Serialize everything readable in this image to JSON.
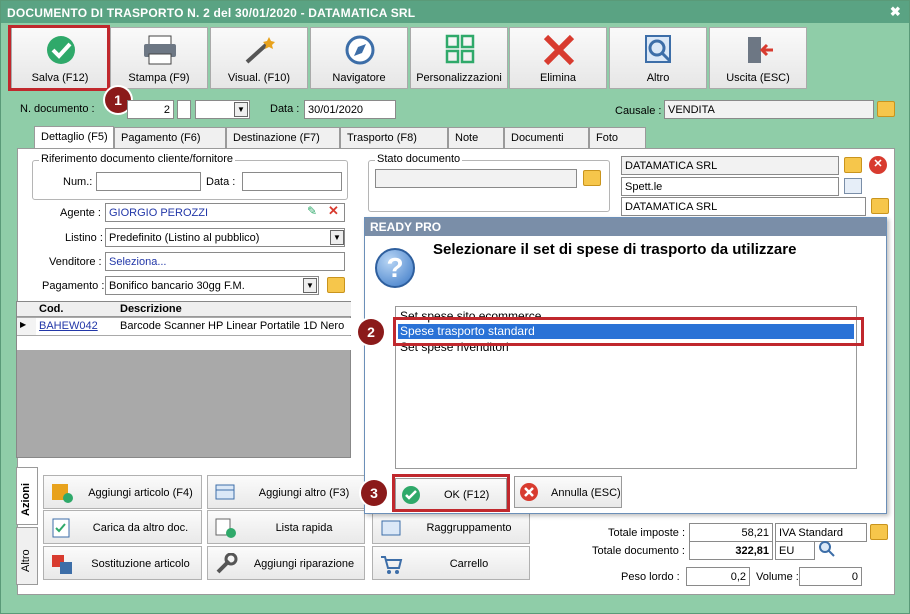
{
  "window": {
    "title": "DOCUMENTO DI TRASPORTO N. 2 del 30/01/2020 - DATAMATICA SRL",
    "close_glyph": "✖"
  },
  "toolbar": [
    {
      "label": "Salva (F12)",
      "icon": "check-icon"
    },
    {
      "label": "Stampa (F9)",
      "icon": "printer-icon"
    },
    {
      "label": "Visual. (F10)",
      "icon": "magic-wand-icon"
    },
    {
      "label": "Navigatore",
      "icon": "compass-icon"
    },
    {
      "label": "Personalizzazioni",
      "icon": "grid-icon"
    },
    {
      "label": "Elimina",
      "icon": "delete-x-icon"
    },
    {
      "label": "Altro",
      "icon": "magnifier-icon"
    },
    {
      "label": "Uscita (ESC)",
      "icon": "exit-door-icon"
    }
  ],
  "header": {
    "num_label": "N. documento :",
    "num_value": "2",
    "data_label": "Data :",
    "data_value": "30/01/2020",
    "causale_label": "Causale :",
    "causale_value": "VENDITA"
  },
  "tabs": [
    "Dettaglio (F5)",
    "Pagamento (F6)",
    "Destinazione (F7)",
    "Trasporto (F8)",
    "Note",
    "Documenti",
    "Foto"
  ],
  "riferimento": {
    "title": "Riferimento documento cliente/fornitore",
    "num_label": "Num.:",
    "data_label": "Data :"
  },
  "stato": {
    "title": "Stato documento"
  },
  "cliente": {
    "line1": "DATAMATICA SRL",
    "line2": "Spett.le",
    "line3": "DATAMATICA SRL"
  },
  "fields": {
    "agente_label": "Agente :",
    "agente_value": "GIORGIO PEROZZI",
    "listino_label": "Listino :",
    "listino_value": "Predefinito (Listino al pubblico)",
    "venditore_label": "Venditore :",
    "venditore_value": "Seleziona...",
    "pagamento_label": "Pagamento :",
    "pagamento_value": "Bonifico bancario 30gg F.M."
  },
  "grid": {
    "headers": [
      "Cod.",
      "Descrizione"
    ],
    "rows": [
      {
        "cod": "BAHEW042",
        "desc": "Barcode Scanner HP Linear Portatile 1D Nero"
      }
    ]
  },
  "side_tabs": [
    "Azioni",
    "Altro"
  ],
  "actions": [
    {
      "label": "Aggiungi articolo (F4)",
      "icon": "add-article-icon"
    },
    {
      "label": "Aggiungi altro (F3)",
      "icon": "add-other-icon"
    },
    {
      "label": "Carica da altro doc.",
      "icon": "load-doc-icon"
    },
    {
      "label": "Lista rapida",
      "icon": "quick-list-icon"
    },
    {
      "label": "Raggruppamento",
      "icon": "group-icon"
    },
    {
      "label": "Sostituzione articolo",
      "icon": "replace-icon"
    },
    {
      "label": "Aggiungi riparazione",
      "icon": "wrench-icon"
    },
    {
      "label": "Carrello",
      "icon": "cart-icon"
    }
  ],
  "totals": {
    "imposte_label": "Totale imposte :",
    "imposte_value": "58,21",
    "iva_value": "IVA Standard",
    "documento_label": "Totale documento :",
    "documento_value": "322,81",
    "valuta": "EU",
    "peso_label": "Peso lordo :",
    "peso_value": "0,2",
    "volume_label": "Volume :",
    "volume_value": "0"
  },
  "dialog": {
    "title": "READY PRO",
    "message": "Selezionare il set di spese di trasporto da utilizzare",
    "options": [
      "Set spese sito ecommerce",
      "Spese trasporto standard",
      "Set spese rivenditori"
    ],
    "selected_index": 1,
    "ok_label": "OK (F12)",
    "cancel_label": "Annulla (ESC)"
  },
  "badges": [
    "1",
    "2",
    "3"
  ],
  "colors": {
    "accent_red": "#c0282d",
    "window_green": "#8fcda8",
    "selection_blue": "#2a72d6"
  }
}
